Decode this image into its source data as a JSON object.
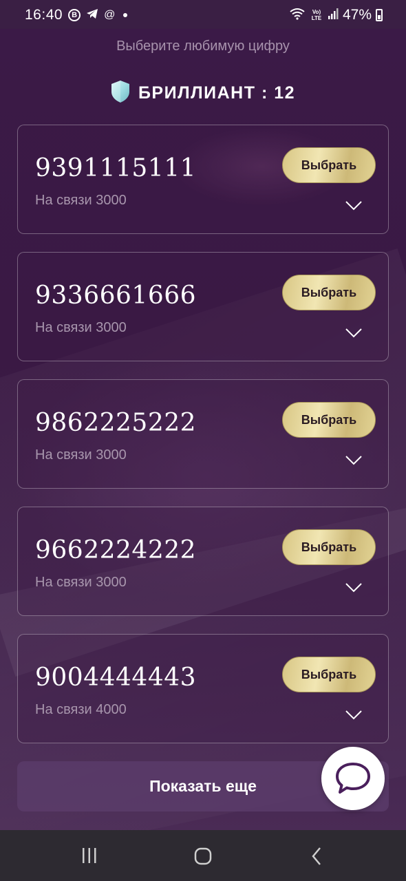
{
  "status_bar": {
    "time": "16:40",
    "notification_icons": [
      "vk-icon",
      "telegram-icon",
      "at-icon",
      "dot-icon"
    ],
    "vk_glyph": "В",
    "at_glyph": "@",
    "network_label": "Vo) LTE",
    "battery": "47%"
  },
  "header": {
    "subtitle": "Выберите любимую цифру",
    "tier_label": "БРИЛЛИАНТ : 12"
  },
  "numbers": [
    {
      "number": "9391115111",
      "subtitle": "На связи 3000",
      "button": "Выбрать"
    },
    {
      "number": "9336661666",
      "subtitle": "На связи 3000",
      "button": "Выбрать"
    },
    {
      "number": "9862225222",
      "subtitle": "На связи 3000",
      "button": "Выбрать"
    },
    {
      "number": "9662224222",
      "subtitle": "На связи 3000",
      "button": "Выбрать"
    },
    {
      "number": "9004444443",
      "subtitle": "На связи 4000",
      "button": "Выбрать"
    }
  ],
  "show_more": "Показать еще",
  "colors": {
    "background": "#3a1b44",
    "gold_button": "#e0cf8f",
    "card_border": "#7a5f82"
  }
}
